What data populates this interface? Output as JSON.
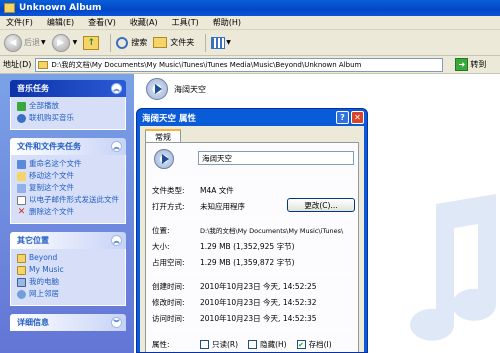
{
  "window": {
    "title": "Unknown Album"
  },
  "menu": [
    "文件(F)",
    "编辑(E)",
    "查看(V)",
    "收藏(A)",
    "工具(T)",
    "帮助(H)"
  ],
  "toolbar": {
    "back": "后退",
    "search": "搜索",
    "folders": "文件夹"
  },
  "address": {
    "label": "地址(D)",
    "path": "D:\\我的文档\\My Documents\\My Music\\iTunes\\iTunes Media\\Music\\Beyond\\Unknown Album",
    "go": "转到"
  },
  "left_panel": {
    "music_tasks": {
      "title": "音乐任务",
      "items": [
        "全部播放",
        "联机购买音乐"
      ]
    },
    "file_tasks": {
      "title": "文件和文件夹任务",
      "items": [
        "重命名这个文件",
        "移动这个文件",
        "复制这个文件",
        "以电子邮件形式发送此文件",
        "删除这个文件"
      ]
    },
    "other_places": {
      "title": "其它位置",
      "items": [
        "Beyond",
        "My Music",
        "我的电脑",
        "网上邻居"
      ]
    },
    "details": {
      "title": "详细信息"
    }
  },
  "file": {
    "name": "海阔天空"
  },
  "dialog": {
    "title": "海阔天空 属性",
    "tab": "常规",
    "name": "海阔天空",
    "type_label": "文件类型:",
    "type_value": "M4A 文件",
    "open_label": "打开方式:",
    "open_value": "未知应用程序",
    "change_button": "更改(C)...",
    "location_label": "位置:",
    "location_value": "D:\\我的文档\\My Documents\\My Music\\iTunes\\",
    "size_label": "大小:",
    "size_value": "1.29 MB (1,352,925 字节)",
    "disk_label": "占用空间:",
    "disk_value": "1.29 MB (1,359,872 字节)",
    "created_label": "创建时间:",
    "created_value": "2010年10月23日 今天, 14:52:25",
    "modified_label": "修改时间:",
    "modified_value": "2010年10月23日 今天, 14:52:32",
    "accessed_label": "访问时间:",
    "accessed_value": "2010年10月23日 今天, 14:52:35",
    "attr_label": "属性:",
    "attrs": [
      {
        "label": "只读(R)",
        "checked": false
      },
      {
        "label": "隐藏(H)",
        "checked": false
      },
      {
        "label": "存档(I)",
        "checked": true
      }
    ]
  }
}
